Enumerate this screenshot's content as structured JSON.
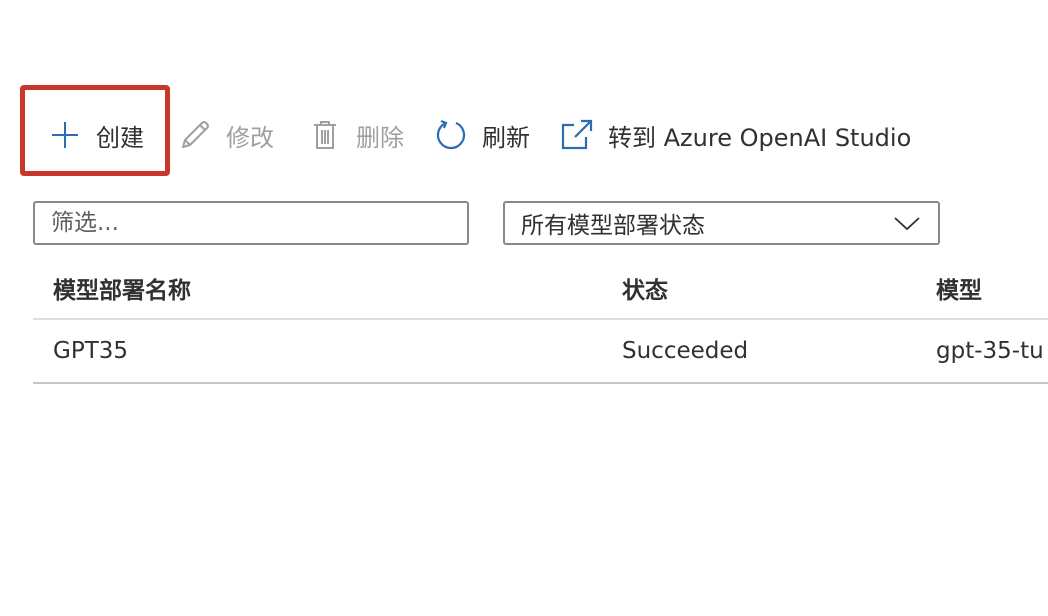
{
  "toolbar": {
    "create_label": "创建",
    "edit_label": "修改",
    "delete_label": "删除",
    "refresh_label": "刷新",
    "open_studio_label": "转到 Azure OpenAI Studio",
    "icons": {
      "create": "plus-icon",
      "edit": "pencil-icon",
      "delete": "trash-icon",
      "refresh": "refresh-icon",
      "open_studio": "external-link-icon"
    }
  },
  "filter": {
    "placeholder": "筛选..."
  },
  "status_filter": {
    "selected": "所有模型部署状态"
  },
  "table": {
    "columns": [
      "模型部署名称",
      "状态",
      "模型"
    ],
    "rows": [
      [
        "GPT35",
        "Succeeded",
        "gpt-35-tu"
      ]
    ]
  },
  "colors": {
    "accent": "#2b6cb5",
    "highlight": "#c8372a",
    "disabled": "#a19f9d"
  }
}
